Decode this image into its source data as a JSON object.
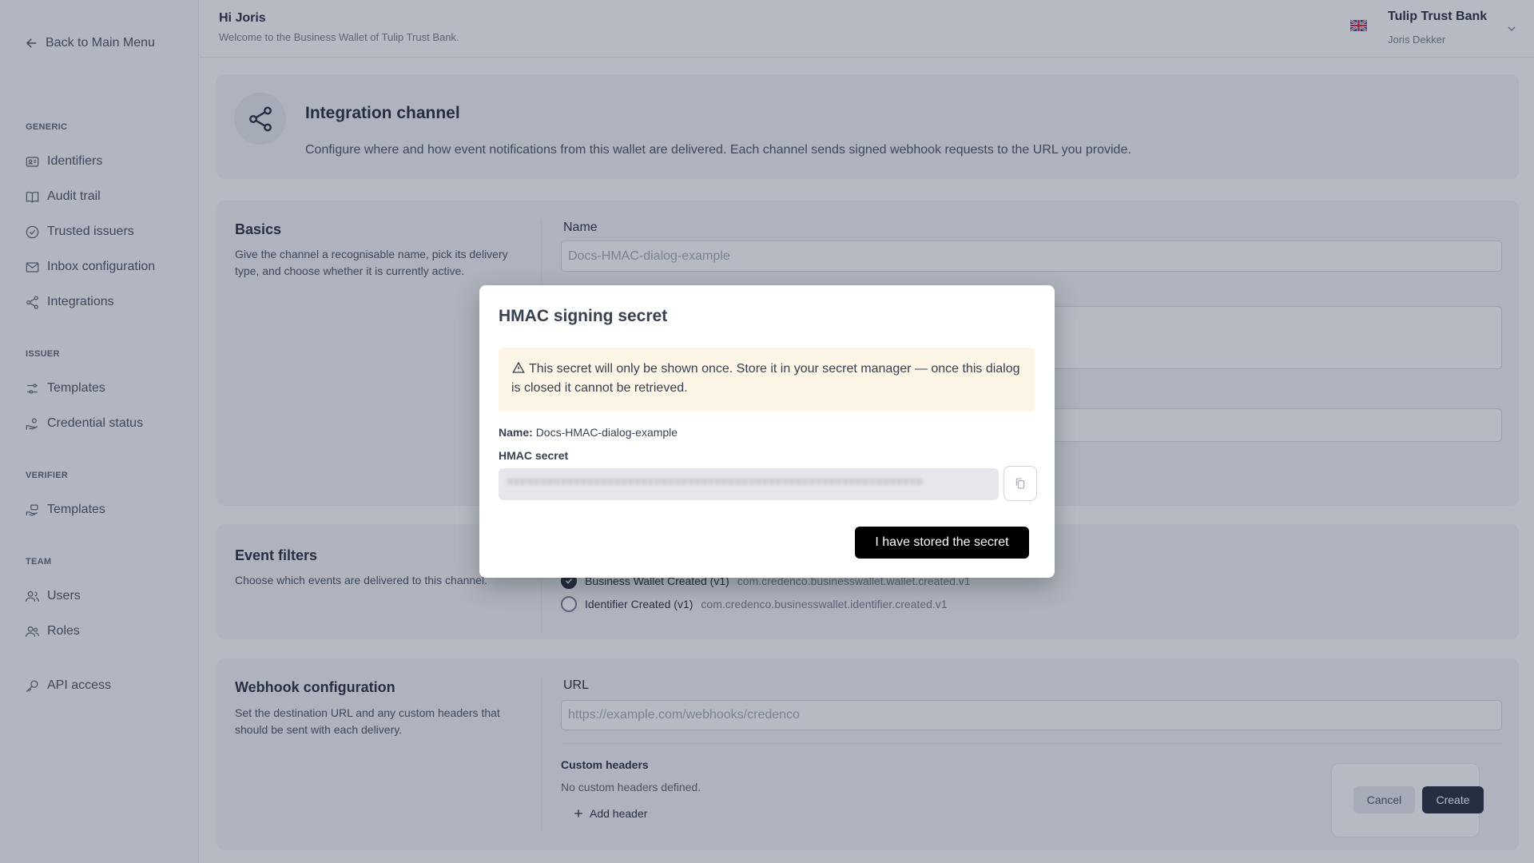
{
  "sidebar": {
    "back_label": "Back to Main Menu",
    "sections": {
      "generic": "GENERIC",
      "issuer": "ISSUER",
      "verifier": "VERIFIER",
      "team": "TEAM"
    },
    "items": {
      "identifiers": "Identifiers",
      "audit_trail": "Audit trail",
      "trusted_issuers": "Trusted issuers",
      "inbox_configuration": "Inbox configuration",
      "integrations": "Integrations",
      "issuer_templates": "Templates",
      "credential_status": "Credential status",
      "verifier_templates": "Templates",
      "users": "Users",
      "roles": "Roles",
      "api_access": "API access"
    }
  },
  "header": {
    "greeting": "Hi Joris",
    "welcome": "Welcome to the Business Wallet of Tulip Trust Bank.",
    "org_name": "Tulip Trust Bank",
    "user_name": "Joris Dekker"
  },
  "intro": {
    "title": "Integration channel",
    "description": "Configure where and how event notifications from this wallet are delivered. Each channel sends signed webhook requests to the URL you provide."
  },
  "basics": {
    "title": "Basics",
    "description": "Give the channel a recognisable name, pick its delivery type, and choose whether it is currently active.",
    "name_label": "Name",
    "name_value": "Docs-HMAC-dialog-example"
  },
  "event_filters": {
    "title": "Event filters",
    "description": "Choose which events are delivered to this channel.",
    "events": [
      {
        "label": "Business Wallet Created (v1)",
        "id": "com.credenco.businesswallet.wallet.created.v1",
        "checked": true
      },
      {
        "label": "Identifier Created (v1)",
        "id": "com.credenco.businesswallet.identifier.created.v1",
        "checked": false
      }
    ]
  },
  "webhook": {
    "title": "Webhook configuration",
    "description": "Set the destination URL and any custom headers that should be sent with each delivery.",
    "url_label": "URL",
    "url_placeholder": "https://example.com/webhooks/credenco",
    "headers_label": "Custom headers",
    "no_headers": "No custom headers defined.",
    "add_header": "Add header"
  },
  "actions": {
    "cancel": "Cancel",
    "create": "Create"
  },
  "dialog": {
    "title": "HMAC signing secret",
    "warning": "This secret will only be shown once. Store it in your secret manager — once this dialog is closed it cannot be retrieved.",
    "name_key": "Name:",
    "name_value": "Docs-HMAC-dialog-example",
    "secret_label": "HMAC secret",
    "confirm": "I have stored the secret"
  }
}
